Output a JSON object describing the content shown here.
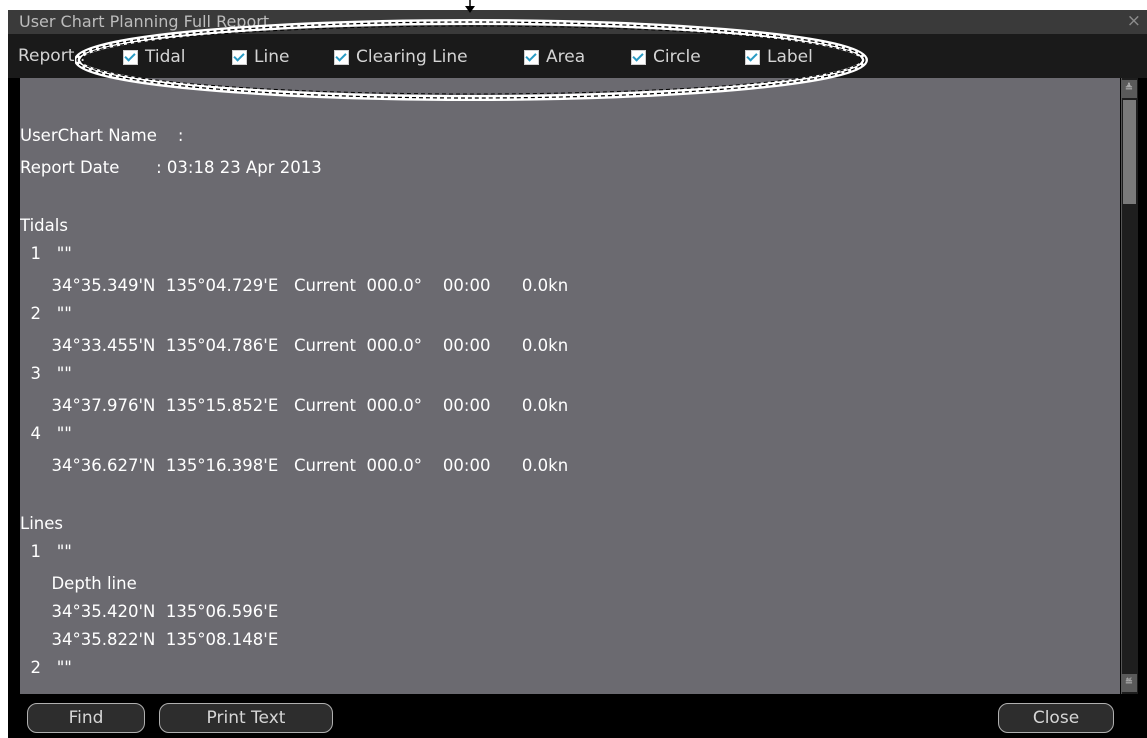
{
  "window": {
    "title": "User Chart Planning Full Report"
  },
  "toolbar": {
    "report_label": "Report :",
    "checkboxes": [
      {
        "label": "Tidal",
        "checked": true
      },
      {
        "label": "Line",
        "checked": true
      },
      {
        "label": "Clearing Line",
        "checked": true
      },
      {
        "label": "Area",
        "checked": true
      },
      {
        "label": "Circle",
        "checked": true
      },
      {
        "label": "Label",
        "checked": true
      }
    ]
  },
  "report": {
    "lines": [
      "UserChart Name    :",
      "Report Date       : 03:18 23 Apr 2013",
      "Tidals",
      "  1   \"\"",
      "      34°35.349'N  135°04.729'E   Current  000.0°    00:00      0.0kn",
      "  2   \"\"",
      "      34°33.455'N  135°04.786'E   Current  000.0°    00:00      0.0kn",
      "  3   \"\"",
      "      34°37.976'N  135°15.852'E   Current  000.0°    00:00      0.0kn",
      "  4   \"\"",
      "      34°36.627'N  135°16.398'E   Current  000.0°    00:00      0.0kn",
      "Lines",
      "  1   \"\"",
      "      Depth line",
      "      34°35.420'N  135°06.596'E",
      "      34°35.822'N  135°08.148'E",
      "  2   \"\""
    ]
  },
  "buttons": {
    "find": "Find",
    "print_text": "Print Text",
    "close": "Close"
  },
  "icons": {
    "close": "×",
    "scroll_up": "≜",
    "scroll_down": "≝"
  },
  "colors": {
    "content_bg": "#6b6a70",
    "checkbox_check": "#2a9bc4"
  }
}
